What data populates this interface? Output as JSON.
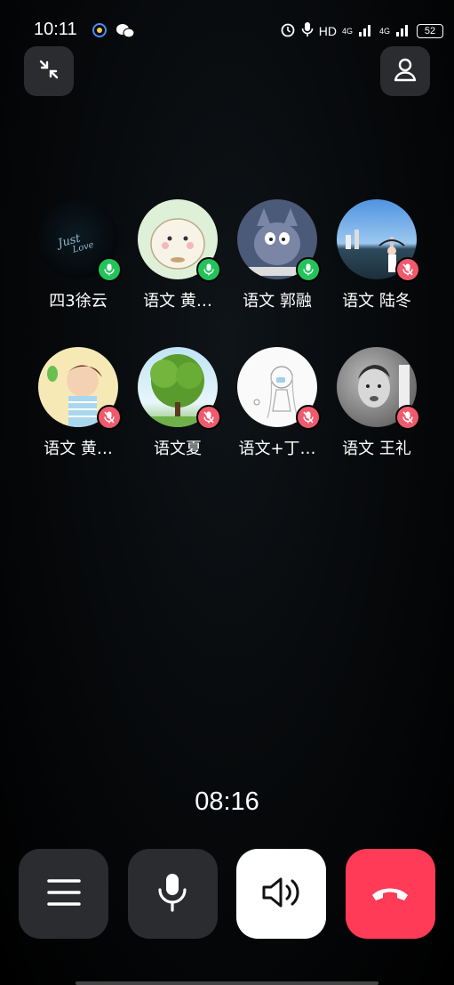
{
  "status_bar": {
    "time": "10:11",
    "network_labels": [
      "HD",
      "4G",
      "4G"
    ],
    "battery": "52"
  },
  "participants": [
    {
      "name": "四3徐云",
      "mic": "on",
      "avatar": "dark-handwriting"
    },
    {
      "name": "语文 黄…",
      "mic": "on",
      "avatar": "cartoon-hamster"
    },
    {
      "name": "语文 郭融",
      "mic": "on",
      "avatar": "cartoon-cat"
    },
    {
      "name": "语文 陆冬",
      "mic": "off",
      "avatar": "waterfront-photo"
    },
    {
      "name": "语文 黄…",
      "mic": "off",
      "avatar": "cartoon-boy"
    },
    {
      "name": "语文夏",
      "mic": "off",
      "avatar": "green-tree"
    },
    {
      "name": "语文+丁…",
      "mic": "off",
      "avatar": "sketch-girl"
    },
    {
      "name": "语文  王礼",
      "mic": "off",
      "avatar": "child-photo"
    }
  ],
  "call_timer": "08:16",
  "colors": {
    "mic_on": "#22c35a",
    "mic_off": "#f05a6d",
    "hangup": "#ff3b57",
    "button_dark": "#2a2c2f"
  }
}
